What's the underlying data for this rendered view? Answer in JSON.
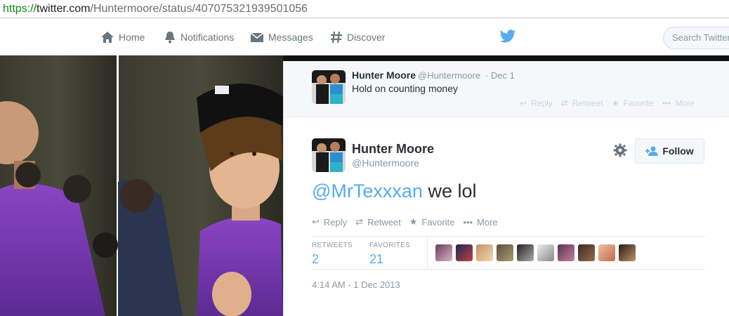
{
  "browser": {
    "url_scheme": "https://",
    "url_host": "twitter.com",
    "url_path": "/Huntermoore/status/407075321939501056"
  },
  "nav": {
    "home": "Home",
    "notifications": "Notifications",
    "messages": "Messages",
    "discover": "Discover",
    "search_placeholder": "Search Twitter"
  },
  "parent_tweet": {
    "name": "Hunter Moore",
    "handle": "@Huntermoore",
    "date": "· Dec 1",
    "text": "Hold on counting money",
    "actions": {
      "reply": "Reply",
      "retweet": "Retweet",
      "favorite": "Favorite",
      "more": "More"
    }
  },
  "tweet": {
    "name": "Hunter Moore",
    "handle": "@Huntermoore",
    "follow_label": "Follow",
    "mention": "@MrTexxxan",
    "text": " we lol",
    "actions": {
      "reply": "Reply",
      "retweet": "Retweet",
      "favorite": "Favorite",
      "more": "More"
    },
    "stats": {
      "retweets_label": "RETWEETS",
      "retweets": "2",
      "favorites_label": "FAVORITES",
      "favorites": "21"
    },
    "timestamp": "4:14 AM - 1 Dec 2013"
  },
  "colors": {
    "accent": "#55acee",
    "purple": "#7a3bb3",
    "text": "#292f33",
    "muted": "#8899a6"
  }
}
